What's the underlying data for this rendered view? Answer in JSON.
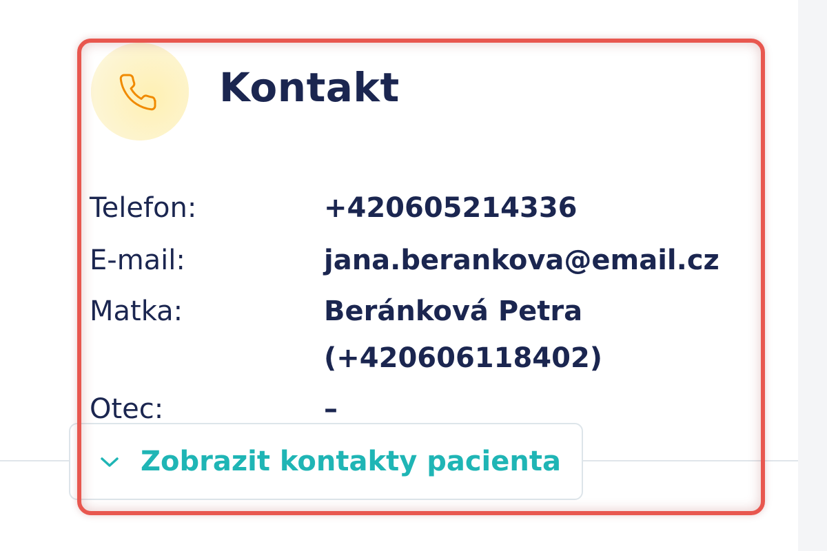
{
  "card": {
    "title": "Kontakt",
    "icon": "phone-icon",
    "accent_color": "#f08a00",
    "avatar_bg": "#fdf3c7"
  },
  "contacts": [
    {
      "label": "Telefon:",
      "value": "+420605214336"
    },
    {
      "label": "E-mail:",
      "value": "jana.berankova@email.cz"
    },
    {
      "label": "Matka:",
      "value": "Beránková Petra",
      "value_line2": "(+420606118402)"
    },
    {
      "label": "Otec:",
      "value": "–"
    }
  ],
  "toggle": {
    "label": "Zobrazit kontakty pacienta",
    "icon": "chevron-down-icon",
    "color": "#1fb5b5"
  },
  "highlight_color": "#e8574f"
}
